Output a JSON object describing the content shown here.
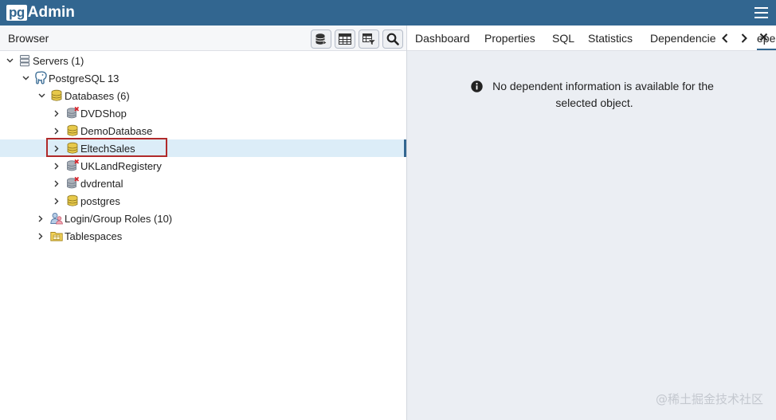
{
  "app": {
    "logo_pg": "pg",
    "logo_admin": "Admin"
  },
  "browser": {
    "title": "Browser",
    "toolbar": [
      "query-tool-icon",
      "view-data-icon",
      "filtered-rows-icon",
      "search-objects-icon"
    ]
  },
  "tree": {
    "servers": "Servers (1)",
    "server": "PostgreSQL 13",
    "databases": "Databases (6)",
    "items": [
      {
        "label": "DVDShop",
        "state": "disconnected"
      },
      {
        "label": "DemoDatabase",
        "state": "connected"
      },
      {
        "label": "EltechSales",
        "state": "connected"
      },
      {
        "label": "UKLandRegistery",
        "state": "disconnected"
      },
      {
        "label": "dvdrental",
        "state": "disconnected"
      },
      {
        "label": "postgres",
        "state": "connected"
      }
    ],
    "roles": "Login/Group Roles (10)",
    "tablespaces": "Tablespaces"
  },
  "tabs": {
    "items": [
      "Dashboard",
      "Properties",
      "SQL",
      "Statistics",
      "Dependencie"
    ],
    "partial": "epe",
    "active": "Dependents"
  },
  "message": {
    "line1": "No dependent information is available for the",
    "line2": "selected object."
  },
  "watermark": "@稀土掘金技术社区",
  "colors": {
    "navbar": "#326690",
    "selected_row": "#dcedf8",
    "highlight_border": "#b02a2a",
    "panel_bg": "#ebeef3"
  }
}
